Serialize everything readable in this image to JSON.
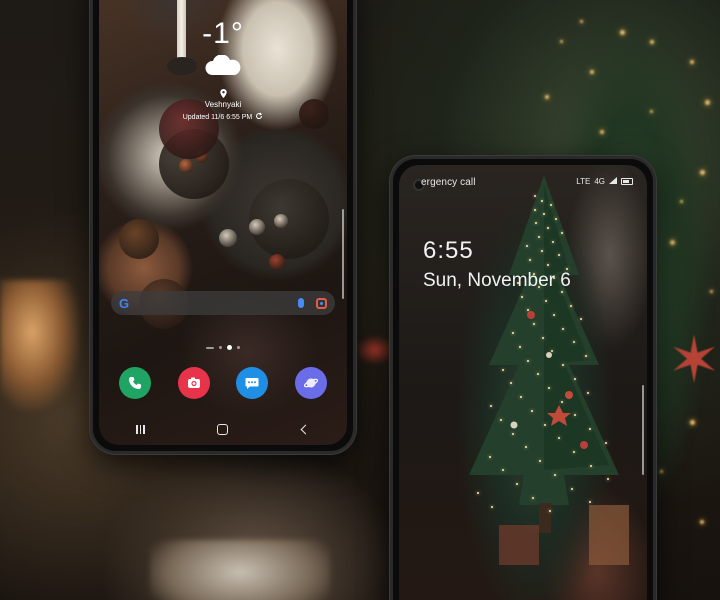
{
  "left_phone": {
    "weather": {
      "temperature": "-1°",
      "condition_icon": "cloud-icon",
      "location_icon": "location-pin-icon",
      "location": "Veshnyaki",
      "updated": "Updated 11/6 6:55 PM",
      "refresh_icon": "refresh-icon"
    },
    "search": {
      "logo": "G",
      "mic_icon": "mic-icon",
      "lens_icon": "lens-icon"
    },
    "dock": [
      {
        "name": "phone",
        "icon": "phone-icon",
        "color": "#1fa463"
      },
      {
        "name": "camera",
        "icon": "camera-icon",
        "color": "#e8344a"
      },
      {
        "name": "messages",
        "icon": "chat-icon",
        "color": "#1f8fe5"
      },
      {
        "name": "internet",
        "icon": "planet-icon",
        "color": "#6b6de8"
      }
    ],
    "navbar": [
      "recent-apps",
      "home",
      "back"
    ]
  },
  "right_phone": {
    "status": {
      "carrier": "ergency call",
      "signal_text": "LTE",
      "network_text": "4G"
    },
    "lock": {
      "time": "6:55",
      "date": "Sun, November 6"
    }
  },
  "colors": {
    "google_blue": "#4285f4",
    "google_red": "#ea4335",
    "google_yellow": "#fbbc05",
    "google_green": "#34a853"
  }
}
